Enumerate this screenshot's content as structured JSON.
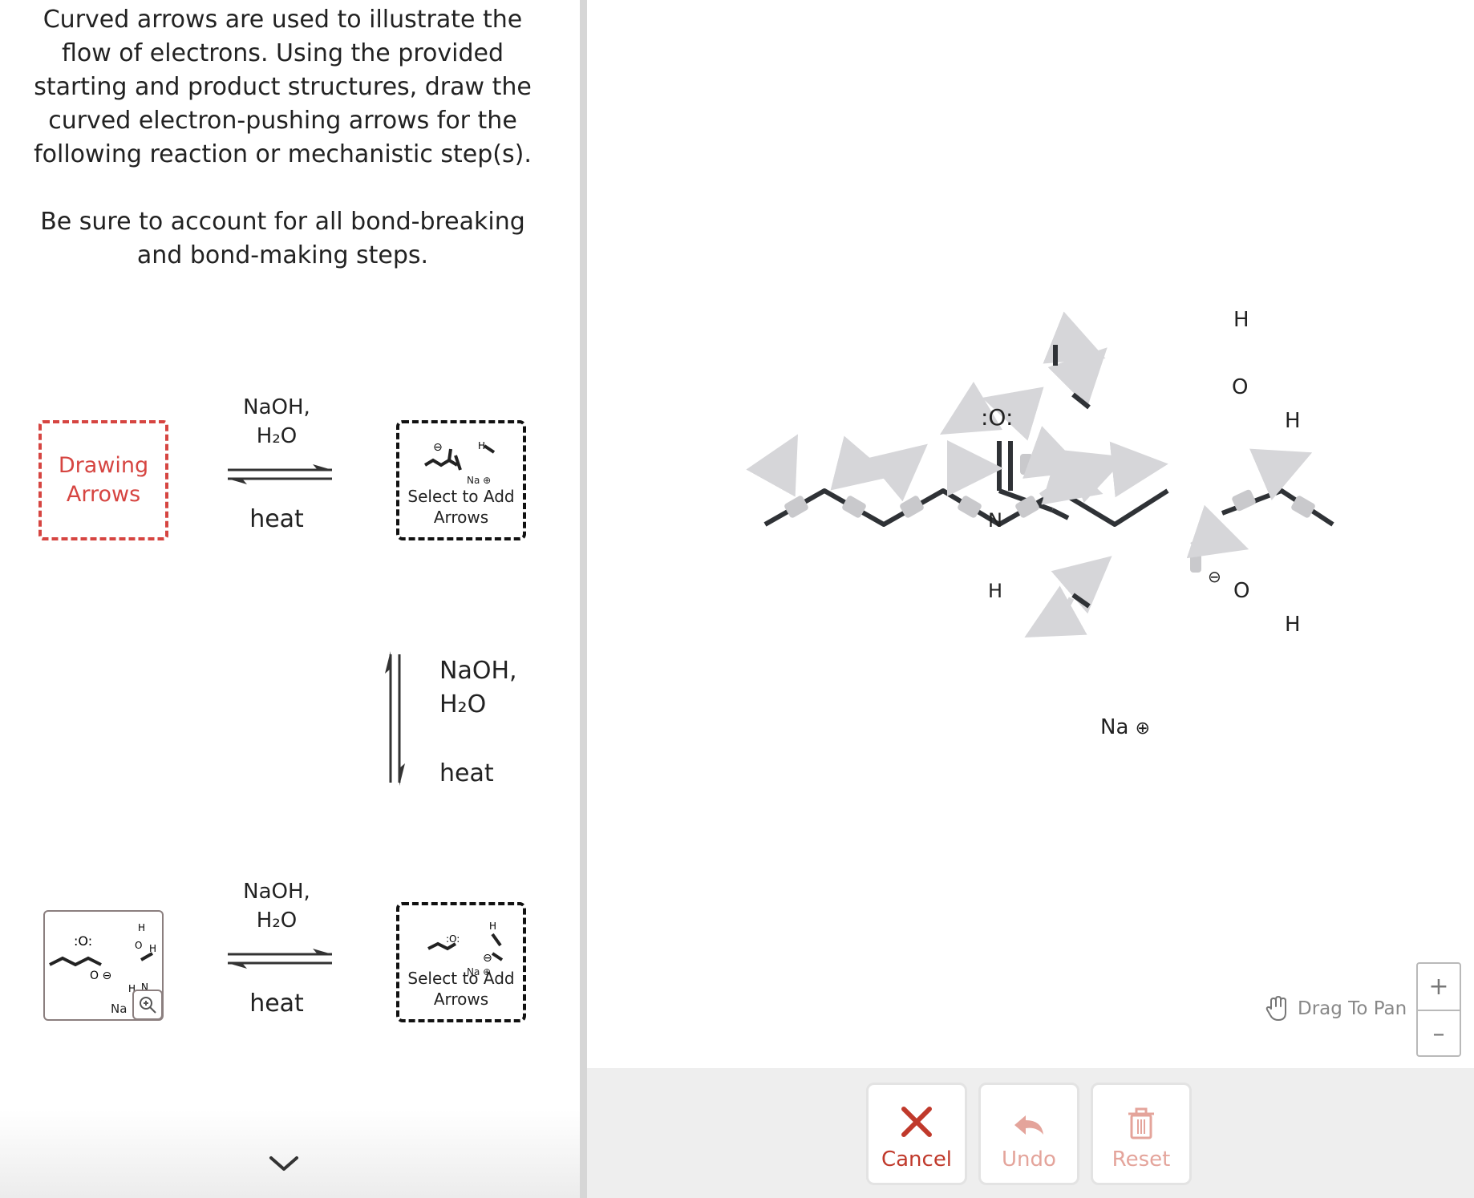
{
  "instructions": {
    "paragraph1": "Curved arrows are used to illustrate the flow of electrons. Using the provided starting and product structures, draw the curved electron-pushing arrows for the following reaction or mechanistic step(s).",
    "paragraph2": "Be sure to account for all bond-breaking and bond-making steps."
  },
  "steps": [
    {
      "start_label": "Drawing Arrows",
      "conditions": [
        "NaOH,",
        "H₂O",
        "heat"
      ],
      "product_label": "Select to Add Arrows",
      "product_na": "Na"
    },
    {
      "conditions": [
        "NaOH,",
        "H₂O",
        "heat"
      ]
    },
    {
      "start_na": "Na",
      "conditions": [
        "NaOH,",
        "H₂O",
        "heat"
      ],
      "product_label": "Select to Add Arrows",
      "product_na": "Na"
    }
  ],
  "canvas": {
    "atoms": {
      "carbonyl_o": ":O:",
      "amide_n": "N",
      "amide_h": "H",
      "water_h_top": "H",
      "water_o": "O",
      "water_h_right": "H",
      "hydroxide_o": "O",
      "hydroxide_h": "H",
      "sodium": "Na"
    },
    "colors": {
      "bond": "#2f3236",
      "handle": "#c9c9cc",
      "arrow": "#d6d6d9",
      "accent_red": "#d64541"
    }
  },
  "toolbar": {
    "cancel_label": "Cancel",
    "undo_label": "Undo",
    "reset_label": "Reset"
  },
  "pan_hint": "Drag To Pan",
  "zoom": {
    "in_label": "+",
    "out_label": "–"
  }
}
